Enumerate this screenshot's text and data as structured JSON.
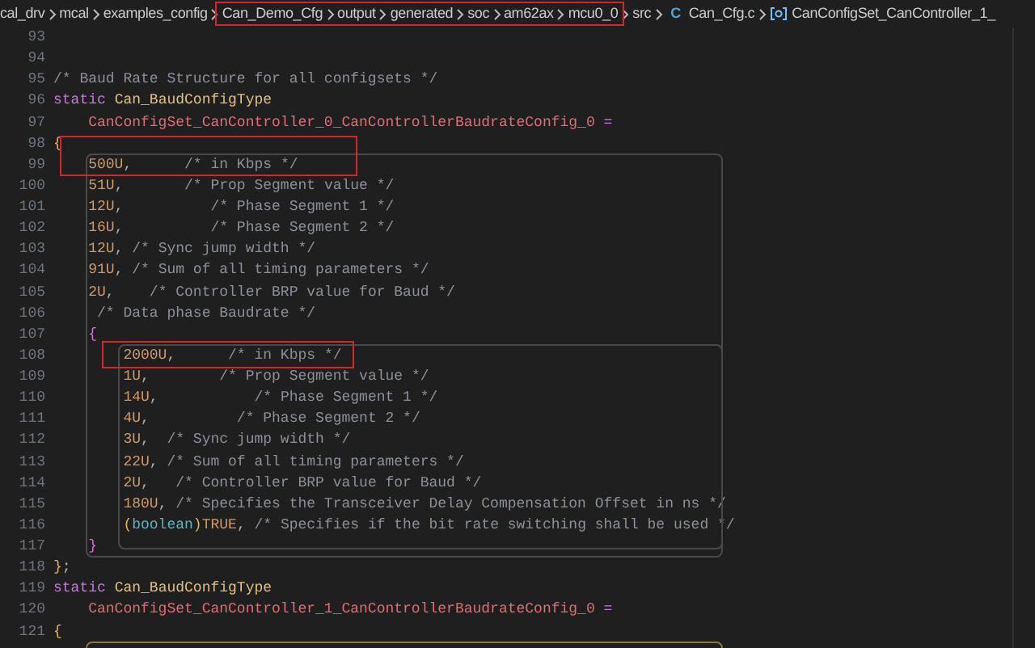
{
  "breadcrumb": {
    "items": [
      {
        "kind": "folder",
        "label": "cal_drv"
      },
      {
        "kind": "folder",
        "label": "mcal"
      },
      {
        "kind": "folder",
        "label": "examples_config"
      },
      {
        "kind": "folder",
        "label": "Can_Demo_Cfg"
      },
      {
        "kind": "folder",
        "label": "output"
      },
      {
        "kind": "folder",
        "label": "generated"
      },
      {
        "kind": "folder",
        "label": "soc"
      },
      {
        "kind": "folder",
        "label": "am62ax"
      },
      {
        "kind": "folder",
        "label": "mcu0_0"
      },
      {
        "kind": "folder",
        "label": "src"
      },
      {
        "kind": "file",
        "badge": "C",
        "label": "Can_Cfg.c"
      },
      {
        "kind": "symbol",
        "label": "CanConfigSet_CanController_1_"
      }
    ]
  },
  "editor": {
    "lines": [
      {
        "number": "93"
      },
      {
        "number": "94"
      },
      {
        "number": "95",
        "tokens": [
          {
            "kind": "comment",
            "text": "/* Baud Rate Structure for all configsets */"
          }
        ]
      },
      {
        "number": "96",
        "tokens": [
          {
            "kind": "keyword",
            "text": "static "
          },
          {
            "kind": "type",
            "text": "Can_BaudConfigType"
          }
        ]
      },
      {
        "number": "97",
        "tokens": [
          {
            "kind": "variable",
            "text": "    CanConfigSet_CanController_0_CanControllerBaudrateConfig_0"
          },
          {
            "kind": "operator",
            "text": " ="
          }
        ]
      },
      {
        "number": "98",
        "tokens": [
          {
            "kind": "brace",
            "text": "{"
          }
        ]
      },
      {
        "number": "99",
        "tokens": [
          {
            "kind": "number",
            "text": "    500U"
          },
          {
            "kind": "plain",
            "text": ","
          },
          {
            "kind": "comment",
            "text": "      /* in Kbps */"
          }
        ]
      },
      {
        "number": "100",
        "tokens": [
          {
            "kind": "number",
            "text": "    51U"
          },
          {
            "kind": "plain",
            "text": ","
          },
          {
            "kind": "comment",
            "text": "       /* Prop Segment value */"
          }
        ]
      },
      {
        "number": "101",
        "tokens": [
          {
            "kind": "number",
            "text": "    12U"
          },
          {
            "kind": "plain",
            "text": ","
          },
          {
            "kind": "comment",
            "text": "          /* Phase Segment 1 */"
          }
        ]
      },
      {
        "number": "102",
        "tokens": [
          {
            "kind": "number",
            "text": "    16U"
          },
          {
            "kind": "plain",
            "text": ","
          },
          {
            "kind": "comment",
            "text": "          /* Phase Segment 2 */"
          }
        ]
      },
      {
        "number": "103",
        "tokens": [
          {
            "kind": "number",
            "text": "    12U"
          },
          {
            "kind": "plain",
            "text": ","
          },
          {
            "kind": "comment",
            "text": " /* Sync jump width */"
          }
        ]
      },
      {
        "number": "104",
        "tokens": [
          {
            "kind": "number",
            "text": "    91U"
          },
          {
            "kind": "plain",
            "text": ","
          },
          {
            "kind": "comment",
            "text": " /* Sum of all timing parameters */"
          }
        ]
      },
      {
        "number": "105",
        "tokens": [
          {
            "kind": "number",
            "text": "    2U"
          },
          {
            "kind": "plain",
            "text": ","
          },
          {
            "kind": "comment",
            "text": "    /* Controller BRP value for Baud */"
          }
        ]
      },
      {
        "number": "106",
        "tokens": [
          {
            "kind": "comment",
            "text": "     /* Data phase Baudrate */"
          }
        ]
      },
      {
        "number": "107",
        "tokens": [
          {
            "kind": "nestedbrace",
            "text": "    {"
          }
        ]
      },
      {
        "number": "108",
        "tokens": [
          {
            "kind": "number",
            "text": "        2000U"
          },
          {
            "kind": "plain",
            "text": ",      "
          },
          {
            "kind": "comment",
            "text": "/* in Kbps */"
          }
        ]
      },
      {
        "number": "109",
        "tokens": [
          {
            "kind": "number",
            "text": "        1U"
          },
          {
            "kind": "plain",
            "text": ","
          },
          {
            "kind": "comment",
            "text": "        /* Prop Segment value */"
          }
        ]
      },
      {
        "number": "110",
        "tokens": [
          {
            "kind": "number",
            "text": "        14U"
          },
          {
            "kind": "plain",
            "text": ","
          },
          {
            "kind": "comment",
            "text": "           /* Phase Segment 1 */"
          }
        ]
      },
      {
        "number": "111",
        "tokens": [
          {
            "kind": "number",
            "text": "        4U"
          },
          {
            "kind": "plain",
            "text": ","
          },
          {
            "kind": "comment",
            "text": "          /* Phase Segment 2 */"
          }
        ]
      },
      {
        "number": "112",
        "tokens": [
          {
            "kind": "number",
            "text": "        3U"
          },
          {
            "kind": "plain",
            "text": ","
          },
          {
            "kind": "comment",
            "text": "  /* Sync jump width */"
          }
        ]
      },
      {
        "number": "113",
        "tokens": [
          {
            "kind": "number",
            "text": "        22U"
          },
          {
            "kind": "plain",
            "text": ","
          },
          {
            "kind": "comment",
            "text": " /* Sum of all timing parameters */"
          }
        ]
      },
      {
        "number": "114",
        "tokens": [
          {
            "kind": "number",
            "text": "        2U"
          },
          {
            "kind": "plain",
            "text": ","
          },
          {
            "kind": "comment",
            "text": "   /* Controller BRP value for Baud */"
          }
        ]
      },
      {
        "number": "115",
        "tokens": [
          {
            "kind": "number",
            "text": "        180U"
          },
          {
            "kind": "plain",
            "text": ","
          },
          {
            "kind": "comment",
            "text": " /* Specifies the Transceiver Delay Compensation Offset in ns */"
          }
        ]
      },
      {
        "number": "116",
        "tokens": [
          {
            "kind": "brace",
            "text": "        ("
          },
          {
            "kind": "cast",
            "text": "boolean"
          },
          {
            "kind": "brace",
            "text": ")"
          },
          {
            "kind": "number",
            "text": "TRUE"
          },
          {
            "kind": "plain",
            "text": ","
          },
          {
            "kind": "comment",
            "text": " /* Specifies if the bit rate switching shall be used */"
          }
        ]
      },
      {
        "number": "117",
        "tokens": [
          {
            "kind": "nestedbrace",
            "text": "    }"
          }
        ]
      },
      {
        "number": "118",
        "tokens": [
          {
            "kind": "brace",
            "text": "}"
          },
          {
            "kind": "plain",
            "text": ";"
          }
        ]
      },
      {
        "number": "119",
        "tokens": [
          {
            "kind": "keyword",
            "text": "static "
          },
          {
            "kind": "type",
            "text": "Can_BaudConfigType"
          }
        ]
      },
      {
        "number": "120",
        "tokens": [
          {
            "kind": "variable",
            "text": "    CanConfigSet_CanController_1_CanControllerBaudrateConfig_0"
          },
          {
            "kind": "operator",
            "text": " ="
          }
        ]
      },
      {
        "number": "121",
        "tokens": [
          {
            "kind": "brace",
            "text": "{"
          }
        ]
      }
    ]
  }
}
